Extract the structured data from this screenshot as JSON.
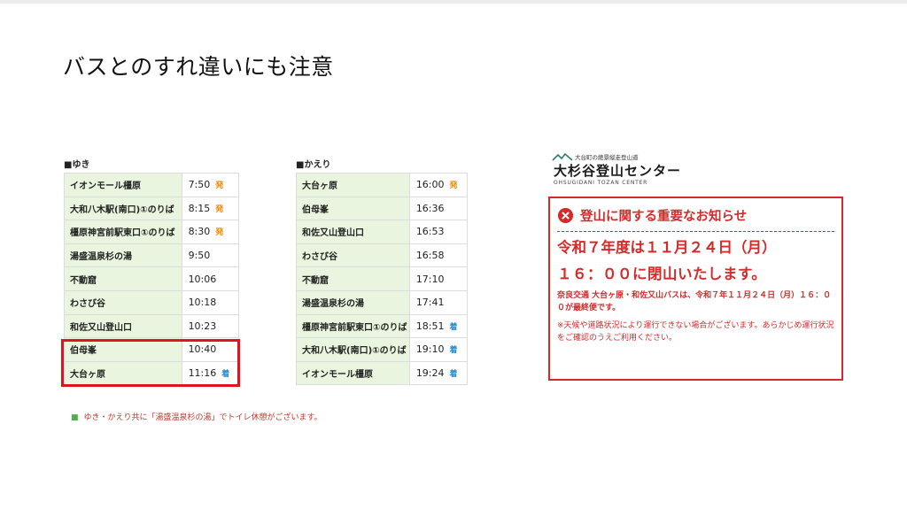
{
  "title": "バスとのすれ違いにも注意",
  "outbound": {
    "label": "■ゆき",
    "rows": [
      {
        "stop": "イオンモール橿原",
        "time": "7:50",
        "mark": "発",
        "type": "dep"
      },
      {
        "stop": "大和八木駅(南口)①のりば",
        "time": "8:15",
        "mark": "発",
        "type": "dep"
      },
      {
        "stop": "橿原神宮前駅東口①のりば",
        "time": "8:30",
        "mark": "発",
        "type": "dep"
      },
      {
        "stop": "湯盛温泉杉の湯",
        "time": "9:50",
        "mark": "",
        "type": ""
      },
      {
        "stop": "不動窟",
        "time": "10:06",
        "mark": "",
        "type": ""
      },
      {
        "stop": "わさび谷",
        "time": "10:18",
        "mark": "",
        "type": ""
      },
      {
        "stop": "和佐又山登山口",
        "time": "10:23",
        "mark": "",
        "type": ""
      },
      {
        "stop": "伯母峯",
        "time": "10:40",
        "mark": "",
        "type": ""
      },
      {
        "stop": "大台ヶ原",
        "time": "11:16",
        "mark": "着",
        "type": "arr"
      }
    ]
  },
  "return": {
    "label": "■かえり",
    "rows": [
      {
        "stop": "大台ヶ原",
        "time": "16:00",
        "mark": "発",
        "type": "dep"
      },
      {
        "stop": "伯母峯",
        "time": "16:36",
        "mark": "",
        "type": ""
      },
      {
        "stop": "和佐又山登山口",
        "time": "16:53",
        "mark": "",
        "type": ""
      },
      {
        "stop": "わさび谷",
        "time": "16:58",
        "mark": "",
        "type": ""
      },
      {
        "stop": "不動窟",
        "time": "17:10",
        "mark": "",
        "type": ""
      },
      {
        "stop": "湯盛温泉杉の湯",
        "time": "17:41",
        "mark": "",
        "type": ""
      },
      {
        "stop": "橿原神宮前駅東口①のりば",
        "time": "18:51",
        "mark": "着",
        "type": "arr"
      },
      {
        "stop": "大和八木駅(南口)①のりば",
        "time": "19:10",
        "mark": "着",
        "type": "arr"
      },
      {
        "stop": "イオンモール橿原",
        "time": "19:24",
        "mark": "着",
        "type": "arr"
      }
    ]
  },
  "note": "ゆき・かえり共に「湯盛温泉杉の湯」でトイレ休憩がございます。",
  "logo": {
    "subtitle": "大台町の絶景縦走登山道",
    "name": "大杉谷登山センター",
    "english": "OHSUGIDANI TOZAN CENTER"
  },
  "notice": {
    "title": "登山に関する重要なお知らせ",
    "line1": "令和７年度は１１月２４日（月）",
    "line2": "１６：００に閉山いたします。",
    "detail": "奈良交通 大台ヶ原・和佐又山バスは、令和７年１１月２４日（月）１６：００が最終便です。",
    "caution": "※天候や道路状況により運行できない場合がございます。あらかじめ運行状況をご確認のうえご利用ください。"
  },
  "colors": {
    "accent_red": "#d42a2a",
    "highlight_red": "#e0141e",
    "stop_bg": "#e9f5df",
    "depart_mark": "#f08a00",
    "arrive_mark": "#2d8fd5"
  }
}
